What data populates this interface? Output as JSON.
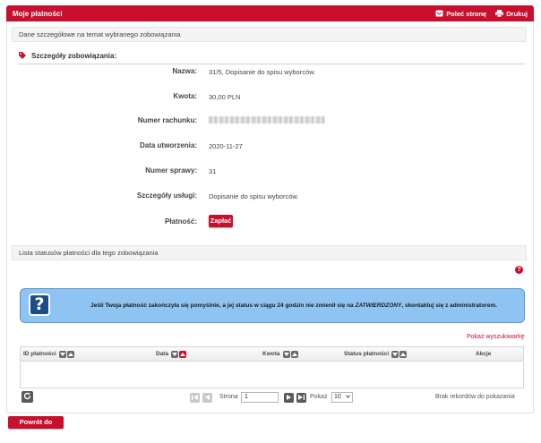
{
  "header": {
    "title": "Moje płatności",
    "recommend_label": "Poleć stronę",
    "print_label": "Drukuj"
  },
  "details_bar": "Dane szczegółowe na temat wybranego zobowiązania",
  "section_title": "Szczegóły zobowiązania:",
  "fields": {
    "name_label": "Nazwa:",
    "name_value": "31/5, Dopisanie do spisu wyborców.",
    "amount_label": "Kwota:",
    "amount_value": "30,00 PLN",
    "account_label": "Numer rachunku:",
    "created_label": "Data utworzenia:",
    "created_value": "2020-11-27",
    "case_label": "Numer sprawy:",
    "case_value": "31",
    "service_label": "Szczegóły usługi:",
    "service_value": "Dopisanie do spisu wyborców.",
    "payment_label": "Płatność:",
    "pay_button": "Zapłać"
  },
  "status_bar": "Lista statusów płatności dla tego zobowiązania",
  "help_glyph": "?",
  "notice": {
    "icon": "?",
    "text_before": "Jeśli Twoja płatność zakończyła się pomyślnie, a jej status w ciągu 24 godzin nie zmienił się na ",
    "status_word": "ZATWIERDZONY",
    "text_after": ", skontaktuj się z administratorem."
  },
  "show_search": "Pokaż wyszukiwarkę",
  "table": {
    "columns": [
      "ID płatności",
      "Data",
      "Kwota",
      "Status płatności",
      "Akcje"
    ]
  },
  "pager": {
    "page_label": "Strona",
    "page_value": "1",
    "show_label": "Pokaż",
    "page_size": "10",
    "empty_text": "Brak rekordów do pokazania"
  },
  "back_button": "Powrót do sprawy",
  "colors": {
    "brand": "#c8102e",
    "notice_bg": "#8fc4f2",
    "notice_icon": "#1d4d86"
  }
}
